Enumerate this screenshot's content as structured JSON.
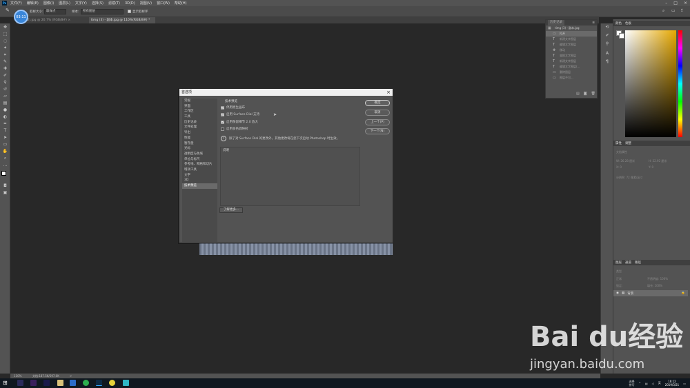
{
  "menubar": {
    "items": [
      "文件(F)",
      "编辑(E)",
      "图像(I)",
      "图层(L)",
      "文字(Y)",
      "选择(S)",
      "滤镜(T)",
      "3D(D)",
      "视图(V)",
      "窗口(W)",
      "帮助(H)"
    ]
  },
  "options": {
    "sample_size_label": "取样大小:",
    "sample_size_value": "取样点",
    "sample_label": "样本:",
    "sample_value": "所有图层",
    "show_ring_label": "显示取样环"
  },
  "avatar": {
    "label": "03:11"
  },
  "tabs": [
    {
      "label": "timg (2).jpg @ 20.7% (RGB/8#) ×"
    },
    {
      "label": "timg (3) - 副本.jpg @ 110%(RGB/8#) *"
    }
  ],
  "status": {
    "zoom": "110%",
    "doc": "文档:187.5K/597.0K",
    "arrow": ">"
  },
  "history": {
    "tabs": [
      "历史记录"
    ],
    "snapshot": "timg (3) - 副本.jpg",
    "rows": [
      "打开",
      "新建文字图层",
      "编辑文字图层",
      "移动",
      "变换文字图层",
      "新建文字图层",
      "编辑文字图层(...",
      "删除图层",
      "图层不可..."
    ]
  },
  "color_panel": {
    "tabs": [
      "颜色",
      "色板"
    ]
  },
  "props_panel": {
    "tabs": [
      "属性",
      "调整"
    ],
    "title": "文档属性",
    "w": "W: 26.28 厘米",
    "h": "H: 22.92 厘米",
    "x": "X: 0",
    "y": "Y: 0",
    "res": "分辨率: 72 像素/英寸"
  },
  "layers_panel": {
    "tabs": [
      "图层",
      "通道",
      "路径"
    ],
    "kind": "类型",
    "blend": "正常",
    "opacity": "不透明度: 100%",
    "lock": "锁定:",
    "fill": "填充: 100%",
    "layer_name": "背景"
  },
  "dialog": {
    "title": "首选项",
    "close": "×",
    "categories": [
      "常规",
      "界面",
      "工作区",
      "工具",
      "历史记录",
      "文件处理",
      "导出",
      "性能",
      "暂存盘",
      "光标",
      "透明度与色域",
      "单位与标尺",
      "参考线、网格和切片",
      "增效工具",
      "文字",
      "3D",
      "技术预览"
    ],
    "selected_index": 16,
    "group_title": "技术预览",
    "options": [
      {
        "label": "停用原生画布",
        "checked": true
      },
      {
        "label": "启用 Surface Dial 支持",
        "checked": true
      },
      {
        "label": "启用保留细节 2.0 放大",
        "checked": true
      },
      {
        "label": "启用多色调映射",
        "checked": false
      }
    ],
    "note": "除了对 Surface Dial 的更改外，其他更改将在您下次启动 Photoshop 时生效。",
    "desc_title": "说明",
    "learn_more": "了解更多...",
    "buttons": {
      "ok": "确定",
      "cancel": "取消",
      "prev": "上一个(P)",
      "next": "下一个(N)"
    }
  },
  "taskbar": {
    "clock_time": "16:12",
    "clock_date": "2019/3/21",
    "ime": "英",
    "lang": "选择\n拼写"
  },
  "watermark": {
    "logo": "Bai du经验",
    "url": "jingyan.baidu.com"
  }
}
